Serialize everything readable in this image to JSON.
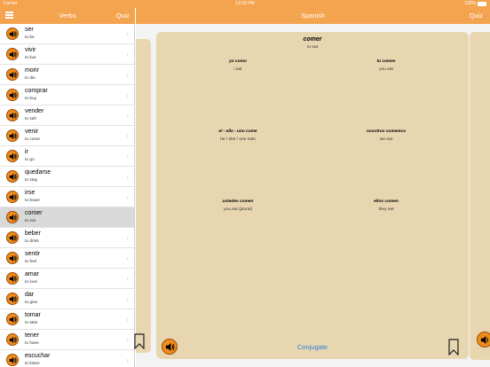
{
  "status": {
    "carrier": "Carrier",
    "time": "12:18 PM",
    "battery": "100%"
  },
  "sidebar_nav": {
    "title": "Verbs",
    "quiz_label": "Quiz"
  },
  "detail_nav": {
    "title": "Spanish",
    "quiz_label": "Quiz"
  },
  "verbs": [
    {
      "word": "ser",
      "translation": "to be"
    },
    {
      "word": "vivir",
      "translation": "to live"
    },
    {
      "word": "morir",
      "translation": "to die"
    },
    {
      "word": "comprar",
      "translation": "to buy"
    },
    {
      "word": "vender",
      "translation": "to sell"
    },
    {
      "word": "venir",
      "translation": "to come"
    },
    {
      "word": "ir",
      "translation": "to go"
    },
    {
      "word": "quedarse",
      "translation": "to stay"
    },
    {
      "word": "irse",
      "translation": "to leave"
    },
    {
      "word": "comer",
      "translation": "to eat"
    },
    {
      "word": "beber",
      "translation": "to drink"
    },
    {
      "word": "sentir",
      "translation": "to feel"
    },
    {
      "word": "amar",
      "translation": "to love"
    },
    {
      "word": "dar",
      "translation": "to give"
    },
    {
      "word": "tomar",
      "translation": "to take"
    },
    {
      "word": "tener",
      "translation": "to have"
    },
    {
      "word": "escuchar",
      "translation": "to listen"
    }
  ],
  "selected_index": 9,
  "card": {
    "verb": "comer",
    "translation": "to eat",
    "conjugations": [
      {
        "pronoun": "yo como",
        "translation": "i eat"
      },
      {
        "pronoun": "tu comes",
        "translation": "you eat"
      },
      {
        "pronoun": "el - ella - uno come",
        "translation": "he / she / one eats"
      },
      {
        "pronoun": "nosotros comemos",
        "translation": "we eat"
      },
      {
        "pronoun": "ustedes comen",
        "translation": "you eat (plural)"
      },
      {
        "pronoun": "ellos comen",
        "translation": "they eat"
      }
    ],
    "conjugate_label": "Conjugate"
  },
  "colors": {
    "accent": "#f4a34f",
    "card": "#e8d6b1",
    "speaker": "#f08c1e",
    "link": "#2d7dd8"
  },
  "icons": {
    "menu": "menu-icon",
    "speaker": "speaker-icon",
    "bookmark": "bookmark-icon",
    "chevron": "chevron-right-icon"
  }
}
